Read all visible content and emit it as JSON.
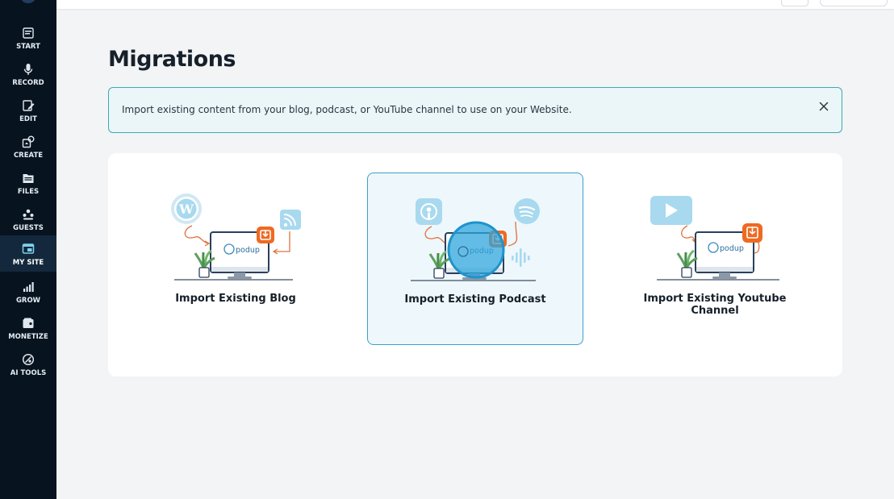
{
  "sidebar": {
    "items": [
      {
        "label": "START",
        "icon": "start-icon"
      },
      {
        "label": "RECORD",
        "icon": "microphone-icon"
      },
      {
        "label": "EDIT",
        "icon": "edit-icon"
      },
      {
        "label": "CREATE",
        "icon": "create-icon"
      },
      {
        "label": "FILES",
        "icon": "folder-icon"
      },
      {
        "label": "GUESTS",
        "icon": "guests-icon"
      },
      {
        "label": "MY SITE",
        "icon": "website-icon",
        "active": true
      },
      {
        "label": "GROW",
        "icon": "chart-icon"
      },
      {
        "label": "MONETIZE",
        "icon": "monetize-icon"
      },
      {
        "label": "AI TOOLS",
        "icon": "ai-tools-icon"
      }
    ]
  },
  "main": {
    "title": "Migrations",
    "banner": {
      "text": "Import existing content from your blog, podcast, or YouTube channel to use on your Website."
    },
    "options": [
      {
        "label": "Import Existing Blog",
        "selected": false
      },
      {
        "label": "Import Existing Podcast",
        "selected": true
      },
      {
        "label": "Import Existing Youtube Channel",
        "selected": false
      }
    ],
    "logo_text": "podup"
  },
  "colors": {
    "sidebar_bg": "#07131f",
    "accent_teal": "#3fa9b2",
    "download_orange": "#ee6a22",
    "light_blue": "#a8d9ef"
  }
}
